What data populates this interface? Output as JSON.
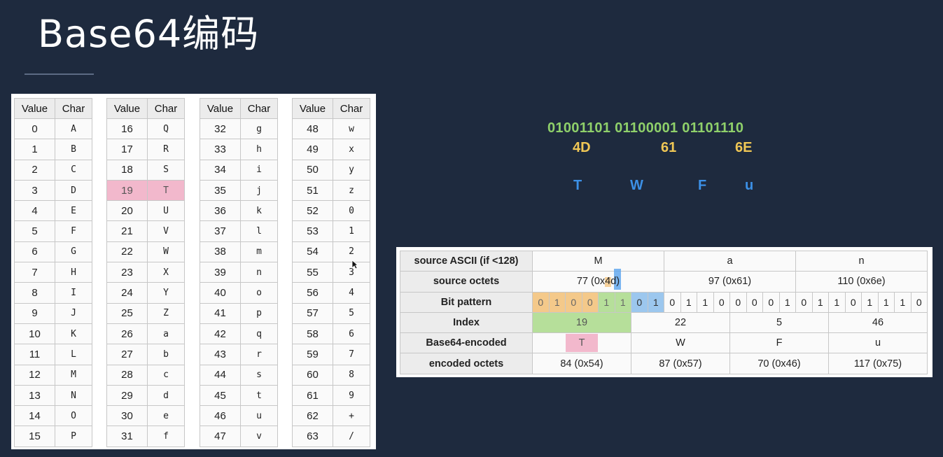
{
  "title": "Base64编码",
  "base64_table": {
    "headers": {
      "value": "Value",
      "char": "Char"
    },
    "blocks": [
      {
        "rows": [
          {
            "v": "0",
            "c": "A"
          },
          {
            "v": "1",
            "c": "B"
          },
          {
            "v": "2",
            "c": "C"
          },
          {
            "v": "3",
            "c": "D"
          },
          {
            "v": "4",
            "c": "E"
          },
          {
            "v": "5",
            "c": "F"
          },
          {
            "v": "6",
            "c": "G"
          },
          {
            "v": "7",
            "c": "H"
          },
          {
            "v": "8",
            "c": "I"
          },
          {
            "v": "9",
            "c": "J"
          },
          {
            "v": "10",
            "c": "K"
          },
          {
            "v": "11",
            "c": "L"
          },
          {
            "v": "12",
            "c": "M"
          },
          {
            "v": "13",
            "c": "N"
          },
          {
            "v": "14",
            "c": "O"
          },
          {
            "v": "15",
            "c": "P"
          }
        ]
      },
      {
        "rows": [
          {
            "v": "16",
            "c": "Q"
          },
          {
            "v": "17",
            "c": "R"
          },
          {
            "v": "18",
            "c": "S"
          },
          {
            "v": "19",
            "c": "T",
            "highlight": true
          },
          {
            "v": "20",
            "c": "U"
          },
          {
            "v": "21",
            "c": "V"
          },
          {
            "v": "22",
            "c": "W"
          },
          {
            "v": "23",
            "c": "X"
          },
          {
            "v": "24",
            "c": "Y"
          },
          {
            "v": "25",
            "c": "Z"
          },
          {
            "v": "26",
            "c": "a"
          },
          {
            "v": "27",
            "c": "b"
          },
          {
            "v": "28",
            "c": "c"
          },
          {
            "v": "29",
            "c": "d"
          },
          {
            "v": "30",
            "c": "e"
          },
          {
            "v": "31",
            "c": "f"
          }
        ]
      },
      {
        "rows": [
          {
            "v": "32",
            "c": "g"
          },
          {
            "v": "33",
            "c": "h"
          },
          {
            "v": "34",
            "c": "i"
          },
          {
            "v": "35",
            "c": "j"
          },
          {
            "v": "36",
            "c": "k"
          },
          {
            "v": "37",
            "c": "l"
          },
          {
            "v": "38",
            "c": "m"
          },
          {
            "v": "39",
            "c": "n"
          },
          {
            "v": "40",
            "c": "o"
          },
          {
            "v": "41",
            "c": "p"
          },
          {
            "v": "42",
            "c": "q"
          },
          {
            "v": "43",
            "c": "r"
          },
          {
            "v": "44",
            "c": "s"
          },
          {
            "v": "45",
            "c": "t"
          },
          {
            "v": "46",
            "c": "u"
          },
          {
            "v": "47",
            "c": "v"
          }
        ]
      },
      {
        "rows": [
          {
            "v": "48",
            "c": "w"
          },
          {
            "v": "49",
            "c": "x"
          },
          {
            "v": "50",
            "c": "y"
          },
          {
            "v": "51",
            "c": "z"
          },
          {
            "v": "52",
            "c": "0"
          },
          {
            "v": "53",
            "c": "1"
          },
          {
            "v": "54",
            "c": "2"
          },
          {
            "v": "55",
            "c": "3"
          },
          {
            "v": "56",
            "c": "4"
          },
          {
            "v": "57",
            "c": "5"
          },
          {
            "v": "58",
            "c": "6"
          },
          {
            "v": "59",
            "c": "7"
          },
          {
            "v": "60",
            "c": "8"
          },
          {
            "v": "61",
            "c": "9"
          },
          {
            "v": "62",
            "c": "+"
          },
          {
            "v": "63",
            "c": "/"
          }
        ]
      }
    ]
  },
  "bits_text": "01001101 01100001 01101110",
  "hex_values": [
    "4D",
    "61",
    "6E"
  ],
  "encoded_letters": [
    "T",
    "W",
    "F",
    "u"
  ],
  "encoding_table": {
    "row_headers": {
      "ascii": "source ASCII (if <128)",
      "octets": "source octets",
      "bits": "Bit pattern",
      "index": "Index",
      "encoded": "Base64-encoded",
      "encoded_octets": "encoded octets"
    },
    "ascii": [
      "M",
      "a",
      "n"
    ],
    "octets": [
      "77 (0x4d)",
      "97 (0x61)",
      "110 (0x6e)"
    ],
    "bits": [
      "0",
      "1",
      "0",
      "0",
      "1",
      "1",
      "0",
      "1",
      "0",
      "1",
      "1",
      "0",
      "0",
      "0",
      "0",
      "1",
      "0",
      "1",
      "1",
      "0",
      "1",
      "1",
      "1",
      "0"
    ],
    "index": [
      "19",
      "22",
      "5",
      "46"
    ],
    "encoded": [
      "T",
      "W",
      "F",
      "u"
    ],
    "encoded_octets": [
      "84 (0x54)",
      "87 (0x57)",
      "70 (0x46)",
      "117 (0x75)"
    ]
  },
  "colors": {
    "background": "#1e2a3e",
    "bits_green": "#8fd06a",
    "hex_yellow": "#f0c755",
    "letter_blue": "#3c90e6",
    "highlight_pink": "#f2b8cc",
    "highlight_green": "#b6df9a",
    "highlight_orange": "#f4c98a",
    "highlight_blue": "#9cc7ee"
  },
  "icons": {
    "cursor": "mouse-pointer-icon"
  }
}
